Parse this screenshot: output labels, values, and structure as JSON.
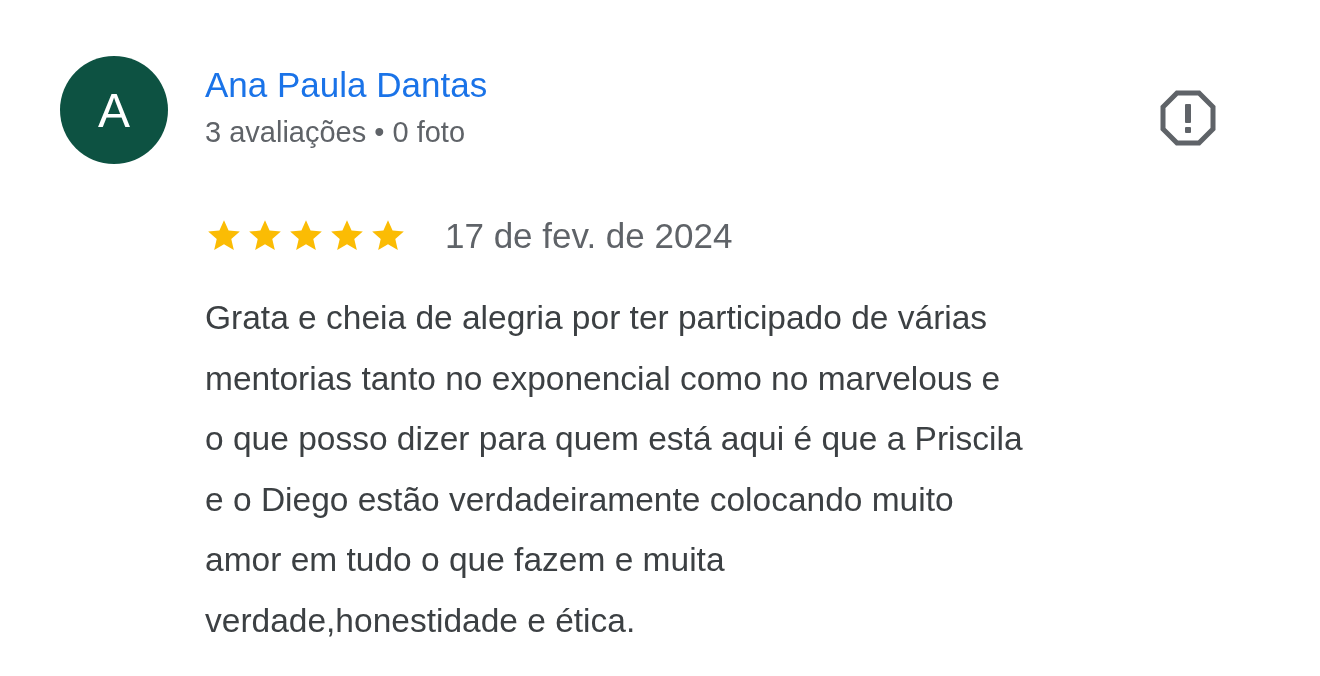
{
  "review": {
    "avatar_letter": "A",
    "author": "Ana Paula Dantas",
    "author_meta": "3 avaliações • 0 foto",
    "stars": 5,
    "date": "17 de fev. de 2024",
    "text_lines": [
      "Grata e cheia de alegria por ter participado de várias",
      "mentorias tanto no exponencial como no marvelous e",
      "o que posso dizer para quem está aqui é que a Priscila",
      "e o Diego estão verdadeiramente colocando muito",
      "amor em tudo o que fazem e muita",
      "verdade,honestidade e ética."
    ]
  }
}
